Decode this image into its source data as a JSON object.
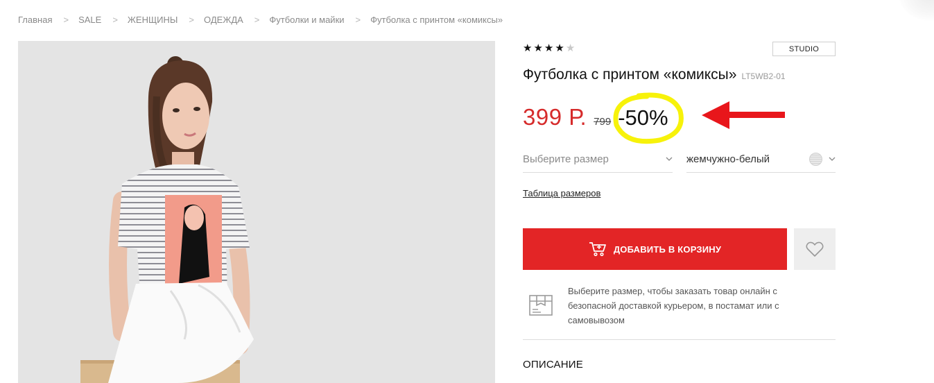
{
  "breadcrumb": {
    "items": [
      "Главная",
      "SALE",
      "ЖЕНЩИНЫ",
      "ОДЕЖДА",
      "Футболки и майки",
      "Футболка с принтом «комиксы»"
    ],
    "separator": ">"
  },
  "product": {
    "rating": {
      "value": 4,
      "max": 5,
      "star_glyph": "★"
    },
    "brand": "STUDIO",
    "title": "Футболка с принтом «комиксы»",
    "sku": "LT5WB2-01",
    "price": {
      "current": "399 Р.",
      "old": "799",
      "discount": "-50%"
    },
    "size_select": {
      "placeholder": "Выберите размер"
    },
    "color_select": {
      "value": "жемчужно-белый"
    },
    "size_table_link": "Таблица размеров",
    "add_to_cart_label": "ДОБАВИТЬ В КОРЗИНУ",
    "delivery_info": "Выберите размер, чтобы заказать товар онлайн с безопасной доставкой курьером, в постамат или с самовывозом",
    "description_heading": "ОПИСАНИЕ"
  },
  "icons": {
    "cart": "shopping-cart-icon",
    "wishlist": "heart-icon",
    "delivery": "package-box-icon",
    "chevron": "chevron-down-icon",
    "swatch": "color-swatch-icon"
  },
  "colors": {
    "accent_red": "#e32526",
    "price_red": "#d62b2b",
    "highlight_yellow": "#f7f20a",
    "arrow_red": "#e8161b"
  }
}
